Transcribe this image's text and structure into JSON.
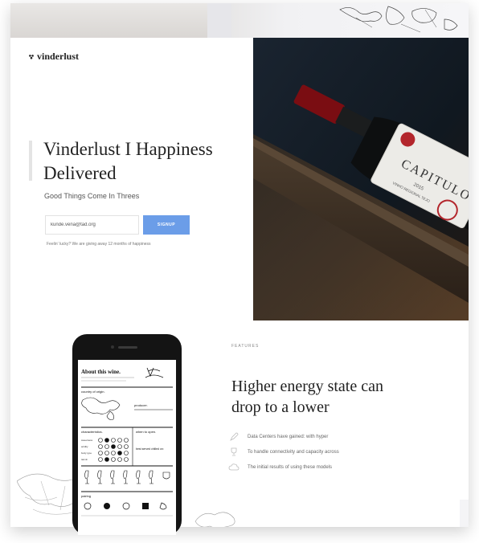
{
  "brand": {
    "name": "vinderlust"
  },
  "hero": {
    "title": "Vinderlust I Happiness Delivered",
    "subtitle": "Good Things Come In Threes",
    "email_value": "kunde.vena@tad.org",
    "signup_label": "SIGNUP",
    "note": "Feelin' lucky? We are giving away 12 months of happiness"
  },
  "photo": {
    "bottle_label": "CAPITULO",
    "bottle_year": "2015",
    "bottle_region": "VINHO REGIONAL TEJO"
  },
  "features": {
    "label": "FEATURES",
    "title": "Higher energy state can drop to a lower",
    "items": [
      {
        "icon": "rocket-icon",
        "text": "Data Centers have gained: with hyper"
      },
      {
        "icon": "trophy-icon",
        "text": "To handle connectivity and capacity across"
      },
      {
        "icon": "cloud-icon",
        "text": "The initial results of using these models"
      }
    ]
  },
  "phone_screen": {
    "title": "About this wine.",
    "country_label": "country of origin.",
    "producer_label": "producer.",
    "characteristics_label": "characteristics.",
    "when_label": "when to open.",
    "sweetness": "sweetness",
    "acidity": "acidity",
    "body_type": "body type",
    "tannin": "tannin",
    "best_served": "best served chilled on:",
    "pairing": "pairing"
  },
  "colors": {
    "accent": "#6b9de8",
    "text": "#222222",
    "muted": "#777777"
  }
}
